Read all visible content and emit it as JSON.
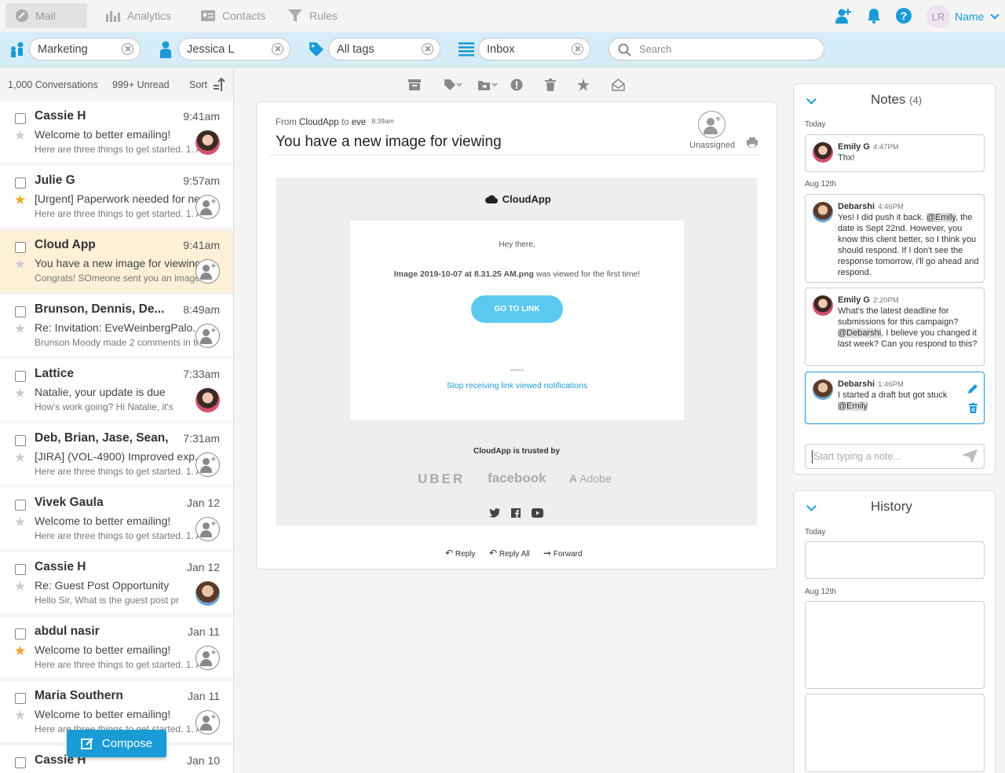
{
  "nav": {
    "tabs": [
      {
        "label": "Mail"
      },
      {
        "label": "Analytics"
      },
      {
        "label": "Contacts"
      },
      {
        "label": "Rules"
      }
    ],
    "user_initials": "LR",
    "user_name": "Name"
  },
  "filters": {
    "team": "Marketing",
    "user": "Jessica L",
    "tags": "All tags",
    "folder": "Inbox",
    "search_placeholder": "Search"
  },
  "list": {
    "conversations": "1,000 Conversations",
    "unread": "999+ Unread",
    "sort": "Sort",
    "items": [
      {
        "name": "Cassie H",
        "time": "9:41am",
        "subject": "Welcome to better emailing!",
        "preview": "Here are three things to get started. 1. A",
        "starred": false,
        "avatar": "photo"
      },
      {
        "name": "Julie G",
        "time": "9:57am",
        "subject": "[Urgent] Paperwork needed for ne",
        "preview": "Here are three things to get started. 1. A",
        "starred": true,
        "avatar": "add"
      },
      {
        "name": "Cloud App",
        "time": "9:41am",
        "subject": "You have a new image for viewing",
        "preview": "Congrats! SOmeone sent you an image",
        "starred": false,
        "avatar": "add"
      },
      {
        "name": "Brunson, Dennis, De...",
        "time": "8:49am",
        "subject": "Re: Invitation: EveWeinbergPalo...",
        "preview": "Brunson Moody made 2 comments in th",
        "starred": false,
        "avatar": "add"
      },
      {
        "name": "Lattice",
        "time": "7:33am",
        "subject": "Natalie, your update is due",
        "preview": "How's work going? Hi Natalie, it's",
        "starred": false,
        "avatar": "photo"
      },
      {
        "name": "Deb, Brian, Jase, Sean,...",
        "time": "7:31am",
        "subject": "[JIRA] (VOL-4900) Improved exp...",
        "preview": "Here are three things to get started. 1. A",
        "starred": false,
        "avatar": "add"
      },
      {
        "name": "Vivek Gaula",
        "time": "Jan  12",
        "subject": "Welcome to better emailing!",
        "preview": "Here are three things to get started. 1. A",
        "starred": false,
        "avatar": "add"
      },
      {
        "name": "Cassie H",
        "time": "Jan 12",
        "subject": "Re: Guest Post Opportunity",
        "preview": "Hello Sir, What is the guest  post pr",
        "starred": false,
        "avatar": "photo2"
      },
      {
        "name": "abdul nasir",
        "time": "Jan 11",
        "subject": "Welcome to better emailing!",
        "preview": "Here are three things to get started. 1. A",
        "starred": true,
        "avatar": "add"
      },
      {
        "name": "Maria Southern",
        "time": "Jan 11",
        "subject": "Welcome to better emailing!",
        "preview": "Here are three things to get started. 1. A",
        "starred": false,
        "avatar": "add"
      },
      {
        "name": "Cassie H",
        "time": "Jan 10",
        "subject": "",
        "preview": "",
        "starred": false,
        "avatar": "none"
      }
    ],
    "compose": "Compose"
  },
  "mail": {
    "from_label": "From",
    "from": "CloudApp",
    "to_label": "to",
    "to": "eve",
    "time": "8:39am",
    "subject": "You have a new image for viewing",
    "assignee": "Unassigned",
    "body": {
      "brand": "CloudApp",
      "greeting": "Hey there,",
      "file": "Image 2019-10-07 at 8.31.25 AM.png",
      "message": " was viewed for the first time!",
      "cta": "GO TO LINK",
      "separator": "-----",
      "unsubscribe": "Stop receiving link viewed notifications",
      "trusted": "CloudApp is trusted by",
      "logos": [
        "UBER",
        "facebook",
        "Adobe"
      ]
    },
    "actions": {
      "reply": "Reply",
      "reply_all": "Reply All",
      "forward": "Forward"
    }
  },
  "notes": {
    "title": "Notes",
    "count": "(4)",
    "groups": {
      "today": "Today",
      "aug": "Aug 12th"
    },
    "items": [
      {
        "author": "Emily G",
        "time": "4:47PM",
        "pre": "Thx!",
        "m1": "",
        "mid": "",
        "m2": "",
        "post": ""
      },
      {
        "author": "Debarshi",
        "time": "4:46PM",
        "pre": "Yes! I did push it back. ",
        "m1": "@Emily",
        "mid": ", the date is Sept 22nd. However, you know this client better, so I think you should respond. If I don't see the response tomorrow, i'll go ahead and respond.",
        "m2": "",
        "post": ""
      },
      {
        "author": "Emily G",
        "time": "2:20PM",
        "pre": "What's the latest deadline for submissions for this campaign? ",
        "m1": "@Debarshi",
        "mid": ", I believe you changed it last week? Can you respond to this?",
        "m2": "",
        "post": ""
      },
      {
        "author": "Debarshi",
        "time": "1:46PM",
        "pre": "I started a draft but got stuck ",
        "m1": "",
        "mid": "",
        "m2": "@Emily",
        "post": ""
      }
    ],
    "input_placeholder": "Start typing a note..."
  },
  "history": {
    "title": "History",
    "today": "Today",
    "aug": "Aug 12th"
  },
  "colors": {
    "accent": "#1a9bd7",
    "filterbar": "#d6ecf8",
    "selected_row": "#fdf0d7",
    "star": "#f5a623"
  }
}
